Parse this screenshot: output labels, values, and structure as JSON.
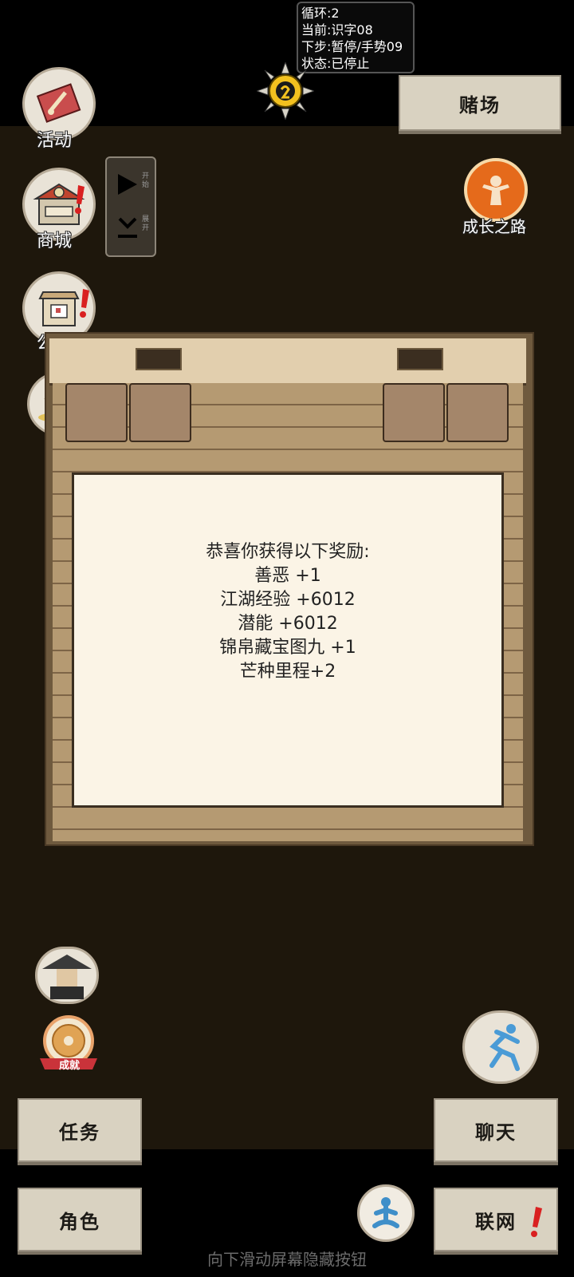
{
  "status_overlay": {
    "lines": [
      "循环:2",
      "当前:识字08",
      "下步:暂停/手势09",
      "状态:已停止"
    ]
  },
  "top": {
    "casino_label": "赌场"
  },
  "sidebar_left": {
    "activity_label": "活动",
    "shop_label": "商城",
    "notice_label": "公告"
  },
  "toggle_panel": {
    "start_label": "开始",
    "expand_label": "展开"
  },
  "growth_label": "成长之路",
  "achievement_label": "成就",
  "reward_popup": {
    "title": "恭喜你获得以下奖励:",
    "items": [
      "善恶 +1",
      "江湖经验 +6012",
      "潜能 +6012",
      "锦帛藏宝图九 +1",
      "芒种里程+2"
    ]
  },
  "bottom_buttons": {
    "task": "任务",
    "chat": "聊天",
    "role": "角色",
    "network": "联网"
  },
  "hint_text": "向下滑动屏幕隐藏按钮",
  "colors": {
    "background": "#1e170c",
    "alert": "#d92020",
    "button_bg": "#d9d2c1"
  }
}
